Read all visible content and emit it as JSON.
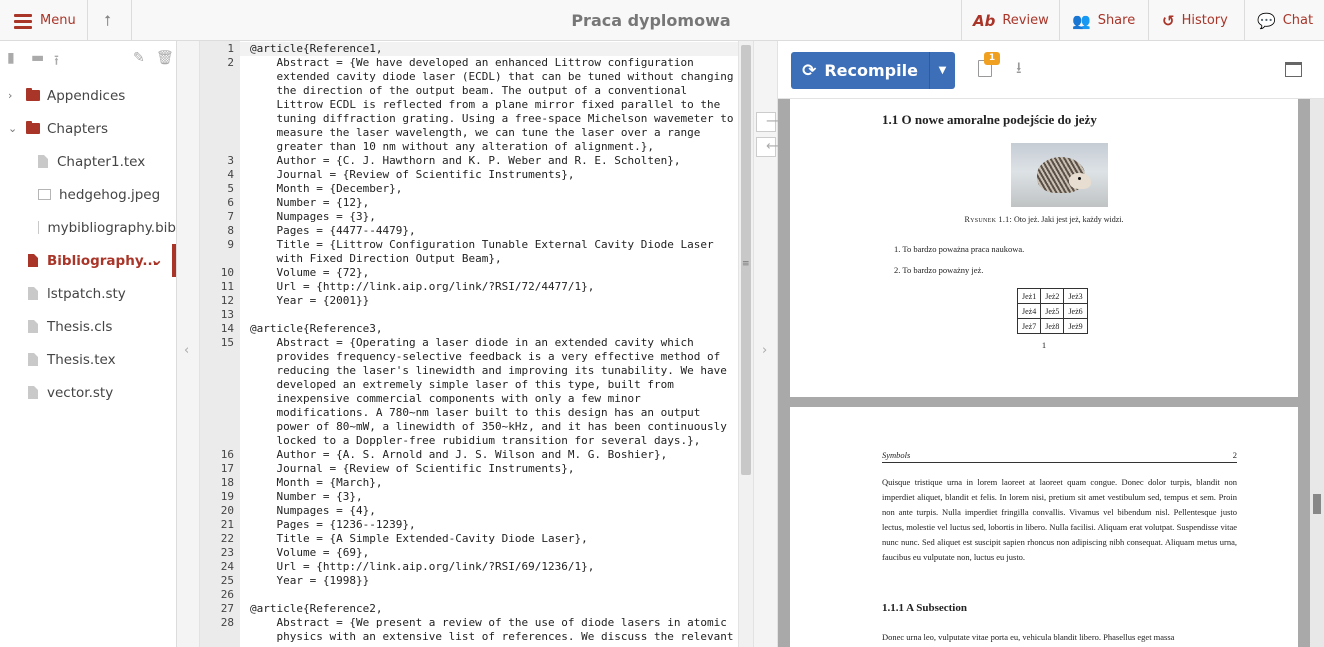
{
  "header": {
    "menu_label": "Menu",
    "project_title": "Praca dyplomowa",
    "review_label": "Review",
    "share_label": "Share",
    "history_label": "History",
    "chat_label": "Chat"
  },
  "file_tree": {
    "items": [
      {
        "label": "Appendices",
        "kind": "folder",
        "expanded": false
      },
      {
        "label": "Chapters",
        "kind": "folder",
        "expanded": true
      },
      {
        "label": "Chapter1.tex",
        "kind": "file"
      },
      {
        "label": "hedgehog.jpeg",
        "kind": "image"
      },
      {
        "label": "mybibliography.bib",
        "kind": "file"
      },
      {
        "label": "Bibliography...",
        "kind": "file",
        "selected": true
      },
      {
        "label": "lstpatch.sty",
        "kind": "file"
      },
      {
        "label": "Thesis.cls",
        "kind": "file"
      },
      {
        "label": "Thesis.tex",
        "kind": "file"
      },
      {
        "label": "vector.sty",
        "kind": "file"
      }
    ]
  },
  "editor": {
    "lines": [
      {
        "n": "1",
        "t": "@article{Reference1,"
      },
      {
        "n": "2",
        "t": "    Abstract = {We have developed an enhanced Littrow configuration"
      },
      {
        "n": "",
        "t": "    extended cavity diode laser (ECDL) that can be tuned without changing"
      },
      {
        "n": "",
        "t": "    the direction of the output beam. The output of a conventional"
      },
      {
        "n": "",
        "t": "    Littrow ECDL is reflected from a plane mirror fixed parallel to the"
      },
      {
        "n": "",
        "t": "    tuning diffraction grating. Using a free-space Michelson wavemeter to"
      },
      {
        "n": "",
        "t": "    measure the laser wavelength, we can tune the laser over a range"
      },
      {
        "n": "",
        "t": "    greater than 10 nm without any alteration of alignment.},"
      },
      {
        "n": "3",
        "t": "    Author = {C. J. Hawthorn and K. P. Weber and R. E. Scholten},"
      },
      {
        "n": "4",
        "t": "    Journal = {Review of Scientific Instruments},"
      },
      {
        "n": "5",
        "t": "    Month = {December},"
      },
      {
        "n": "6",
        "t": "    Number = {12},"
      },
      {
        "n": "7",
        "t": "    Numpages = {3},"
      },
      {
        "n": "8",
        "t": "    Pages = {4477--4479},"
      },
      {
        "n": "9",
        "t": "    Title = {Littrow Configuration Tunable External Cavity Diode Laser"
      },
      {
        "n": "",
        "t": "    with Fixed Direction Output Beam},"
      },
      {
        "n": "10",
        "t": "    Volume = {72},"
      },
      {
        "n": "11",
        "t": "    Url = {http://link.aip.org/link/?RSI/72/4477/1},"
      },
      {
        "n": "12",
        "t": "    Year = {2001}}"
      },
      {
        "n": "13",
        "t": ""
      },
      {
        "n": "14",
        "t": "@article{Reference3,"
      },
      {
        "n": "15",
        "t": "    Abstract = {Operating a laser diode in an extended cavity which"
      },
      {
        "n": "",
        "t": "    provides frequency-selective feedback is a very effective method of"
      },
      {
        "n": "",
        "t": "    reducing the laser's linewidth and improving its tunability. We have"
      },
      {
        "n": "",
        "t": "    developed an extremely simple laser of this type, built from"
      },
      {
        "n": "",
        "t": "    inexpensive commercial components with only a few minor"
      },
      {
        "n": "",
        "t": "    modifications. A 780~nm laser built to this design has an output"
      },
      {
        "n": "",
        "t": "    power of 80~mW, a linewidth of 350~kHz, and it has been continuously"
      },
      {
        "n": "",
        "t": "    locked to a Doppler-free rubidium transition for several days.},"
      },
      {
        "n": "16",
        "t": "    Author = {A. S. Arnold and J. S. Wilson and M. G. Boshier},"
      },
      {
        "n": "17",
        "t": "    Journal = {Review of Scientific Instruments},"
      },
      {
        "n": "18",
        "t": "    Month = {March},"
      },
      {
        "n": "19",
        "t": "    Number = {3},"
      },
      {
        "n": "20",
        "t": "    Numpages = {4},"
      },
      {
        "n": "21",
        "t": "    Pages = {1236--1239},"
      },
      {
        "n": "22",
        "t": "    Title = {A Simple Extended-Cavity Diode Laser},"
      },
      {
        "n": "23",
        "t": "    Volume = {69},"
      },
      {
        "n": "24",
        "t": "    Url = {http://link.aip.org/link/?RSI/69/1236/1},"
      },
      {
        "n": "25",
        "t": "    Year = {1998}}"
      },
      {
        "n": "26",
        "t": ""
      },
      {
        "n": "27",
        "t": "@article{Reference2,"
      },
      {
        "n": "28",
        "t": "    Abstract = {We present a review of the use of diode lasers in atomic"
      },
      {
        "n": "",
        "t": "    physics with an extensive list of references. We discuss the relevant"
      }
    ]
  },
  "pdf_toolbar": {
    "recompile_label": "Recompile",
    "logs_badge": "1"
  },
  "pdf": {
    "page1": {
      "section": "1.1   O nowe amoralne podejście do jeży",
      "caption_label": "Rysunek 1.1:",
      "caption_text": "Oto jeż. Jaki jest jeż, każdy widzi.",
      "list": [
        "1.  To bardzo poważna praca naukowa.",
        "2.  To bardzo poważny jeż."
      ],
      "grid": [
        [
          "Jeż1",
          "Jeż2",
          "Jeż3"
        ],
        [
          "Jeż4",
          "Jeż5",
          "Jeż6"
        ],
        [
          "Jeż7",
          "Jeż8",
          "Jeż9"
        ]
      ],
      "page_number": "1"
    },
    "page2": {
      "header_left": "Symbols",
      "header_right": "2",
      "paragraph": "Quisque tristique urna in lorem laoreet at laoreet quam congue. Donec dolor turpis, blandit non imperdiet aliquet, blandit et felis. In lorem nisi, pretium sit amet vestibulum sed, tempus et sem. Proin non ante turpis. Nulla imperdiet fringilla convallis. Vivamus vel bibendum nisl. Pellentesque justo lectus, molestie vel luctus sed, lobortis in libero. Nulla facilisi. Aliquam erat volutpat. Suspendisse vitae nunc nunc. Sed aliquet est suscipit sapien rhoncus non adipiscing nibh consequat. Aliquam metus urna, faucibus eu vulputate non, luctus eu justo.",
      "subsection": "1.1.1   A Subsection",
      "paragraph2": "Donec urna leo, vulputate vitae porta eu, vehicula blandit libero. Phasellus eget massa"
    }
  },
  "colors": {
    "accent": "#a93529",
    "recompile": "#3c6fb8",
    "badge": "#f0a020"
  }
}
